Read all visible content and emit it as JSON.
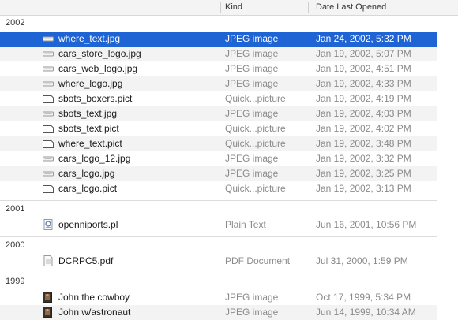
{
  "columns": {
    "name": "",
    "kind": "Kind",
    "date": "Date Last Opened"
  },
  "groups": [
    {
      "year": "2002",
      "rows": [
        {
          "name": "where_text.jpg",
          "kind": "JPEG image",
          "date": "Jan 24, 2002, 5:32 PM",
          "icon": "jpeg-file-icon",
          "selected": true
        },
        {
          "name": "cars_store_logo.jpg",
          "kind": "JPEG image",
          "date": "Jan 19, 2002, 5:07 PM",
          "icon": "jpeg-file-icon"
        },
        {
          "name": "cars_web_logo.jpg",
          "kind": "JPEG image",
          "date": "Jan 19, 2002, 4:51 PM",
          "icon": "jpeg-file-icon"
        },
        {
          "name": "where_logo.jpg",
          "kind": "JPEG image",
          "date": "Jan 19, 2002, 4:33 PM",
          "icon": "jpeg-file-icon"
        },
        {
          "name": "sbots_boxers.pict",
          "kind": "Quick...picture",
          "date": "Jan 19, 2002, 4:19 PM",
          "icon": "pict-file-icon"
        },
        {
          "name": "sbots_text.jpg",
          "kind": "JPEG image",
          "date": "Jan 19, 2002, 4:03 PM",
          "icon": "jpeg-file-icon"
        },
        {
          "name": "sbots_text.pict",
          "kind": "Quick...picture",
          "date": "Jan 19, 2002, 4:02 PM",
          "icon": "pict-file-icon"
        },
        {
          "name": "where_text.pict",
          "kind": "Quick...picture",
          "date": "Jan 19, 2002, 3:48 PM",
          "icon": "pict-file-icon"
        },
        {
          "name": "cars_logo_12.jpg",
          "kind": "JPEG image",
          "date": "Jan 19, 2002, 3:32 PM",
          "icon": "jpeg-file-icon"
        },
        {
          "name": "cars_logo.jpg",
          "kind": "JPEG image",
          "date": "Jan 19, 2002, 3:25 PM",
          "icon": "jpeg-file-icon"
        },
        {
          "name": "cars_logo.pict",
          "kind": "Quick...picture",
          "date": "Jan 19, 2002, 3:13 PM",
          "icon": "pict-file-icon"
        }
      ]
    },
    {
      "year": "2001",
      "rows": [
        {
          "name": "openniports.pl",
          "kind": "Plain Text",
          "date": "Jun 16, 2001, 10:56 PM",
          "icon": "text-file-icon"
        }
      ]
    },
    {
      "year": "2000",
      "rows": [
        {
          "name": "DCRPC5.pdf",
          "kind": "PDF Document",
          "date": "Jul 31, 2000, 1:59 PM",
          "icon": "pdf-file-icon"
        }
      ]
    },
    {
      "year": "1999",
      "rows": [
        {
          "name": "John the cowboy",
          "kind": "JPEG image",
          "date": "Oct 17, 1999, 5:34 PM",
          "icon": "photo-thumbnail-icon"
        },
        {
          "name": "John w/astronaut",
          "kind": "JPEG image",
          "date": "Jun 14, 1999, 10:34 AM",
          "icon": "photo-thumbnail-icon"
        }
      ]
    }
  ],
  "colors": {
    "selection": "#1f64d4",
    "alt_row": "#f3f3f3",
    "secondary_text": "#8a8a8a"
  }
}
